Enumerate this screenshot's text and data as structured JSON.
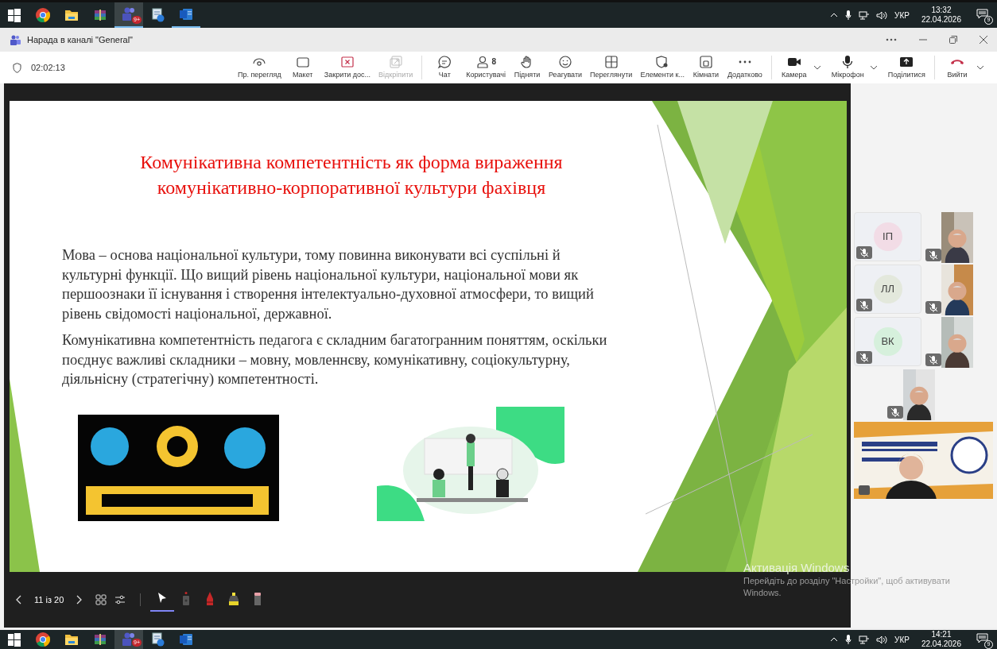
{
  "taskbar_top": {
    "apps": [
      {
        "kind": "start",
        "selected": false,
        "running": false
      },
      {
        "kind": "chrome",
        "selected": false,
        "running": false
      },
      {
        "kind": "folder",
        "selected": false,
        "running": false
      },
      {
        "kind": "archive",
        "selected": false,
        "running": false
      },
      {
        "kind": "teams",
        "selected": true,
        "running": true,
        "badge": "9+"
      },
      {
        "kind": "tool",
        "selected": false,
        "running": false
      },
      {
        "kind": "word",
        "selected": false,
        "running": true
      }
    ],
    "tray": {
      "language": "УКР",
      "time": "13:32",
      "date": "22.04.2026",
      "notifications": "9"
    }
  },
  "window": {
    "title": "Нарада в каналі \"General\""
  },
  "toolbar": {
    "timer": "02:02:13",
    "groups": [
      [
        {
          "kind": "eye",
          "label": "Пр. перегляд",
          "disabled": false
        },
        {
          "kind": "layout",
          "label": "Макет",
          "disabled": false
        },
        {
          "kind": "stop",
          "label": "Закрити дос...",
          "disabled": false
        },
        {
          "kind": "unpin",
          "label": "Відкріпити",
          "disabled": true
        }
      ],
      [
        {
          "kind": "chat",
          "label": "Чат",
          "disabled": false
        },
        {
          "kind": "people",
          "label": "Користувачі",
          "disabled": false,
          "badge": "8"
        },
        {
          "kind": "hand",
          "label": "Підняти",
          "disabled": false
        },
        {
          "kind": "smile",
          "label": "Реагувати",
          "disabled": false
        },
        {
          "kind": "view",
          "label": "Переглянути",
          "disabled": false
        },
        {
          "kind": "shield",
          "label": "Елементи к...",
          "disabled": false
        },
        {
          "kind": "rooms",
          "label": "Кімнати",
          "disabled": false
        },
        {
          "kind": "more",
          "label": "Додатково",
          "disabled": false
        }
      ],
      [
        {
          "kind": "camera",
          "label": "Камера",
          "disabled": false,
          "menu": true
        },
        {
          "kind": "mic",
          "label": "Мікрофон",
          "disabled": false,
          "menu": true
        },
        {
          "kind": "share",
          "label": "Поділитися",
          "disabled": false
        }
      ],
      [
        {
          "kind": "leave",
          "label": "Вийти",
          "disabled": false,
          "menu": true
        }
      ]
    ]
  },
  "slide": {
    "title_lines": [
      "Комунікативна компетентність як форма вираження",
      "комунікативно-корпоративної культури фахівця"
    ],
    "paragraphs": [
      "Мова – основа національної культури, тому повинна виконувати всі суспільні й культурні функції. Що вищий рівень національної культури, національної мови як першоознаки її існування і створення інтелектуально-духовної атмосфери, то вищий рівень свідомості національної, державної.",
      "Комунікативна компетентність педагога є складним багатогранним поняттям, оскільки поєднує важливі складники – мовну, мовленнєву, комунікативну, соціокультурну, діяльнісну (стратегічну) компетентності."
    ],
    "images": [
      {
        "kind": "picture"
      },
      {
        "kind": "picture"
      }
    ]
  },
  "presentation_controls": {
    "page": "11 із 20",
    "tools": [
      {
        "kind": "pointer",
        "selected": true
      },
      {
        "kind": "laser",
        "selected": false
      },
      {
        "kind": "pen",
        "selected": false
      },
      {
        "kind": "highlighter",
        "selected": false
      },
      {
        "kind": "eraser",
        "selected": false
      }
    ]
  },
  "participants": {
    "rows": [
      [
        {
          "kind": "avatar",
          "initials": "ІП",
          "color": "#f2dce6",
          "muted": true
        },
        {
          "kind": "video",
          "muted": true
        }
      ],
      [
        {
          "kind": "avatar",
          "initials": "ЛЛ",
          "color": "#e3e8dc",
          "muted": true
        },
        {
          "kind": "video",
          "muted": true
        }
      ],
      [
        {
          "kind": "avatar",
          "initials": "ВК",
          "color": "#d6f0dc",
          "muted": true
        },
        {
          "kind": "video",
          "muted": true
        }
      ],
      [
        {
          "kind": "video",
          "muted": true
        }
      ]
    ],
    "presenter": {
      "kind": "picture"
    }
  },
  "activation": {
    "title": "Активація Windows",
    "text": "Перейдіть до розділу \"Настройки\", щоб активувати Windows."
  },
  "taskbar_bottom": {
    "apps": [
      {
        "kind": "start",
        "selected": false,
        "running": false
      },
      {
        "kind": "chrome",
        "selected": false,
        "running": false
      },
      {
        "kind": "folder",
        "selected": false,
        "running": false
      },
      {
        "kind": "archive",
        "selected": false,
        "running": false
      },
      {
        "kind": "teams",
        "selected": true,
        "running": false,
        "badge": "9+"
      },
      {
        "kind": "tool",
        "selected": false,
        "running": false
      },
      {
        "kind": "word",
        "selected": false,
        "running": false
      }
    ],
    "tray": {
      "language": "УКР",
      "time": "14:21",
      "date": "22.04.2026",
      "notifications": "9"
    }
  }
}
